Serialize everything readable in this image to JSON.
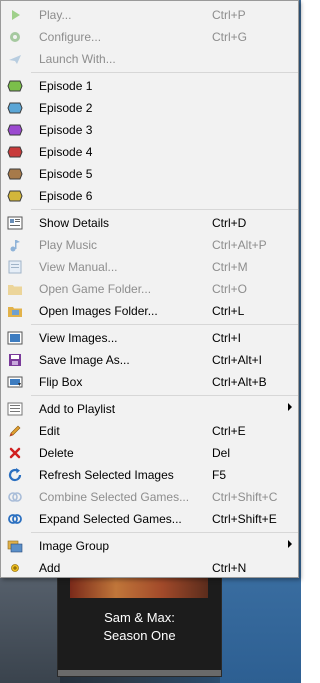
{
  "menu": {
    "items": [
      {
        "label": "Play...",
        "shortcut": "Ctrl+P",
        "icon": "play-icon",
        "disabled": true
      },
      {
        "label": "Configure...",
        "shortcut": "Ctrl+G",
        "icon": "configure-icon",
        "disabled": true
      },
      {
        "label": "Launch With...",
        "shortcut": "",
        "icon": "launch-with-icon",
        "disabled": true
      },
      {
        "label": "Episode 1",
        "shortcut": "",
        "icon": "episode-icon",
        "color": "#7bbf4a",
        "disabled": false
      },
      {
        "label": "Episode 2",
        "shortcut": "",
        "icon": "episode-icon",
        "color": "#5aa6d6",
        "disabled": false
      },
      {
        "label": "Episode 3",
        "shortcut": "",
        "icon": "episode-icon",
        "color": "#9b4ad0",
        "disabled": false
      },
      {
        "label": "Episode 4",
        "shortcut": "",
        "icon": "episode-icon",
        "color": "#c83a3a",
        "disabled": false
      },
      {
        "label": "Episode 5",
        "shortcut": "",
        "icon": "episode-icon",
        "color": "#a77a4a",
        "disabled": false
      },
      {
        "label": "Episode 6",
        "shortcut": "",
        "icon": "episode-icon",
        "color": "#d2b63a",
        "disabled": false
      },
      {
        "label": "Show Details",
        "shortcut": "Ctrl+D",
        "icon": "details-icon",
        "disabled": false
      },
      {
        "label": "Play Music",
        "shortcut": "Ctrl+Alt+P",
        "icon": "music-icon",
        "disabled": true
      },
      {
        "label": "View Manual...",
        "shortcut": "Ctrl+M",
        "icon": "manual-icon",
        "disabled": true
      },
      {
        "label": "Open Game Folder...",
        "shortcut": "Ctrl+O",
        "icon": "folder-icon",
        "disabled": true
      },
      {
        "label": "Open Images Folder...",
        "shortcut": "Ctrl+L",
        "icon": "images-folder-icon",
        "disabled": false
      },
      {
        "label": "View Images...",
        "shortcut": "Ctrl+I",
        "icon": "view-images-icon",
        "disabled": false
      },
      {
        "label": "Save Image As...",
        "shortcut": "Ctrl+Alt+I",
        "icon": "save-icon",
        "disabled": false
      },
      {
        "label": "Flip Box",
        "shortcut": "Ctrl+Alt+B",
        "icon": "flip-box-icon",
        "disabled": false
      },
      {
        "label": "Add to Playlist",
        "shortcut": "",
        "icon": "playlist-icon",
        "submenu": true,
        "disabled": false
      },
      {
        "label": "Edit",
        "shortcut": "Ctrl+E",
        "icon": "edit-icon",
        "disabled": false
      },
      {
        "label": "Delete",
        "shortcut": "Del",
        "icon": "delete-icon",
        "disabled": false
      },
      {
        "label": "Refresh Selected Images",
        "shortcut": "F5",
        "icon": "refresh-icon",
        "disabled": false
      },
      {
        "label": "Combine Selected Games...",
        "shortcut": "Ctrl+Shift+C",
        "icon": "combine-icon",
        "disabled": true
      },
      {
        "label": "Expand Selected Games...",
        "shortcut": "Ctrl+Shift+E",
        "icon": "expand-icon",
        "disabled": false
      },
      {
        "label": "Image Group",
        "shortcut": "",
        "icon": "image-group-icon",
        "submenu": true,
        "disabled": false
      },
      {
        "label": "Add",
        "shortcut": "Ctrl+N",
        "icon": "add-icon",
        "disabled": false
      }
    ]
  },
  "background": {
    "card_title": "Sam & Max:\nSeason One"
  }
}
